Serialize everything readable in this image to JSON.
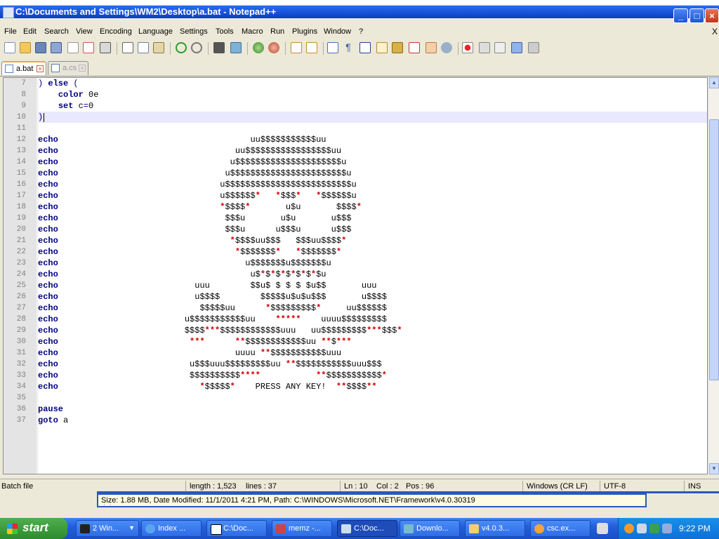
{
  "window": {
    "title": "C:\\Documents and Settings\\WM2\\Desktop\\a.bat - Notepad++",
    "minimize": "_",
    "maximize": "□",
    "close": "×"
  },
  "menu": {
    "items": [
      "File",
      "Edit",
      "Search",
      "View",
      "Encoding",
      "Language",
      "Settings",
      "Tools",
      "Macro",
      "Run",
      "Plugins",
      "Window",
      "?"
    ],
    "close_glyph": "X"
  },
  "tabs": [
    {
      "label": "a.bat",
      "active": true
    },
    {
      "label": "a.cs",
      "active": false
    }
  ],
  "editor": {
    "lines": [
      {
        "n": "7",
        "segs": [
          [
            "op",
            ") "
          ],
          [
            "kw",
            "else"
          ],
          [
            "op",
            " ("
          ]
        ]
      },
      {
        "n": "8",
        "segs": [
          [
            "st",
            "    "
          ],
          [
            "kw",
            "color"
          ],
          [
            "st",
            " 0e"
          ]
        ]
      },
      {
        "n": "9",
        "segs": [
          [
            "st",
            "    "
          ],
          [
            "kw",
            "set"
          ],
          [
            "st",
            " c"
          ],
          [
            "op",
            "="
          ],
          [
            "st",
            "0"
          ]
        ]
      },
      {
        "n": "10",
        "segs": [
          [
            "op",
            ")"
          ]
        ]
      },
      {
        "n": "11",
        "segs": []
      },
      {
        "n": "12",
        "segs": [
          [
            "kw",
            "echo"
          ],
          [
            "st",
            "                                      uu$$$$$$$$$$$uu"
          ]
        ]
      },
      {
        "n": "13",
        "segs": [
          [
            "kw",
            "echo"
          ],
          [
            "st",
            "                                   uu$$$$$$$$$$$$$$$$$uu"
          ]
        ]
      },
      {
        "n": "14",
        "segs": [
          [
            "kw",
            "echo"
          ],
          [
            "st",
            "                                  u$$$$$$$$$$$$$$$$$$$$$u"
          ]
        ]
      },
      {
        "n": "15",
        "segs": [
          [
            "kw",
            "echo"
          ],
          [
            "st",
            "                                 u$$$$$$$$$$$$$$$$$$$$$$$u"
          ]
        ]
      },
      {
        "n": "16",
        "segs": [
          [
            "kw",
            "echo"
          ],
          [
            "st",
            "                                u$$$$$$$$$$$$$$$$$$$$$$$$$u"
          ]
        ]
      },
      {
        "n": "17",
        "segs": [
          [
            "kw",
            "echo"
          ],
          [
            "st",
            "                                u$$$$$$"
          ],
          [
            "red",
            "*"
          ],
          [
            "st",
            "   "
          ],
          [
            "red",
            "*"
          ],
          [
            "st",
            "$$$"
          ],
          [
            "red",
            "*"
          ],
          [
            "st",
            "   "
          ],
          [
            "red",
            "*"
          ],
          [
            "st",
            "$$$$$$u"
          ]
        ]
      },
      {
        "n": "18",
        "segs": [
          [
            "kw",
            "echo"
          ],
          [
            "st",
            "                                "
          ],
          [
            "red",
            "*"
          ],
          [
            "st",
            "$$$$"
          ],
          [
            "red",
            "*"
          ],
          [
            "st",
            "       u$u       $$$$"
          ],
          [
            "red",
            "*"
          ]
        ]
      },
      {
        "n": "19",
        "segs": [
          [
            "kw",
            "echo"
          ],
          [
            "st",
            "                                 $$$u       u$u       u$$$"
          ]
        ]
      },
      {
        "n": "20",
        "segs": [
          [
            "kw",
            "echo"
          ],
          [
            "st",
            "                                 $$$u      u$$$u      u$$$"
          ]
        ]
      },
      {
        "n": "21",
        "segs": [
          [
            "kw",
            "echo"
          ],
          [
            "st",
            "                                  "
          ],
          [
            "red",
            "*"
          ],
          [
            "st",
            "$$$$uu$$$   $$$uu$$$$"
          ],
          [
            "red",
            "*"
          ]
        ]
      },
      {
        "n": "22",
        "segs": [
          [
            "kw",
            "echo"
          ],
          [
            "st",
            "                                   "
          ],
          [
            "red",
            "*"
          ],
          [
            "st",
            "$$$$$$$"
          ],
          [
            "red",
            "*"
          ],
          [
            "st",
            "   "
          ],
          [
            "red",
            "*"
          ],
          [
            "st",
            "$$$$$$$"
          ],
          [
            "red",
            "*"
          ]
        ]
      },
      {
        "n": "23",
        "segs": [
          [
            "kw",
            "echo"
          ],
          [
            "st",
            "                                     u$$$$$$$u$$$$$$$u"
          ]
        ]
      },
      {
        "n": "24",
        "segs": [
          [
            "kw",
            "echo"
          ],
          [
            "st",
            "                                      u$"
          ],
          [
            "red",
            "*"
          ],
          [
            "st",
            "$"
          ],
          [
            "red",
            "*"
          ],
          [
            "st",
            "$"
          ],
          [
            "red",
            "*"
          ],
          [
            "st",
            "$"
          ],
          [
            "red",
            "*"
          ],
          [
            "st",
            "$"
          ],
          [
            "red",
            "*"
          ],
          [
            "st",
            "$"
          ],
          [
            "red",
            "*"
          ],
          [
            "st",
            "$u"
          ]
        ]
      },
      {
        "n": "25",
        "segs": [
          [
            "kw",
            "echo"
          ],
          [
            "st",
            "                           uuu        $$u$ $ $ $ $u$$       uuu"
          ]
        ]
      },
      {
        "n": "26",
        "segs": [
          [
            "kw",
            "echo"
          ],
          [
            "st",
            "                           u$$$$        $$$$$u$u$u$$$       u$$$$"
          ]
        ]
      },
      {
        "n": "27",
        "segs": [
          [
            "kw",
            "echo"
          ],
          [
            "st",
            "                            $$$$$uu      "
          ],
          [
            "red",
            "*"
          ],
          [
            "st",
            "$$$$$$$$$"
          ],
          [
            "red",
            "*"
          ],
          [
            "st",
            "     uu$$$$$$"
          ]
        ]
      },
      {
        "n": "28",
        "segs": [
          [
            "kw",
            "echo"
          ],
          [
            "st",
            "                         u$$$$$$$$$$$uu    "
          ],
          [
            "red",
            "*****"
          ],
          [
            "st",
            "    uuuu$$$$$$$$$"
          ]
        ]
      },
      {
        "n": "29",
        "segs": [
          [
            "kw",
            "echo"
          ],
          [
            "st",
            "                         $$$$"
          ],
          [
            "red",
            "***"
          ],
          [
            "st",
            "$$$$$$$$$$$$uuu   uu$$$$$$$$$"
          ],
          [
            "red",
            "***"
          ],
          [
            "st",
            "$$$"
          ],
          [
            "red",
            "*"
          ]
        ]
      },
      {
        "n": "30",
        "segs": [
          [
            "kw",
            "echo"
          ],
          [
            "st",
            "                          "
          ],
          [
            "red",
            "***"
          ],
          [
            "st",
            "      "
          ],
          [
            "red",
            "**"
          ],
          [
            "st",
            "$$$$$$$$$$$$uu "
          ],
          [
            "red",
            "**"
          ],
          [
            "st",
            "$"
          ],
          [
            "red",
            "***"
          ]
        ]
      },
      {
        "n": "31",
        "segs": [
          [
            "kw",
            "echo"
          ],
          [
            "st",
            "                                   uuuu "
          ],
          [
            "red",
            "**"
          ],
          [
            "st",
            "$$$$$$$$$$$uuu"
          ]
        ]
      },
      {
        "n": "32",
        "segs": [
          [
            "kw",
            "echo"
          ],
          [
            "st",
            "                          u$$$uuu$$$$$$$$$uu "
          ],
          [
            "red",
            "**"
          ],
          [
            "st",
            "$$$$$$$$$$$uuu$$$"
          ]
        ]
      },
      {
        "n": "33",
        "segs": [
          [
            "kw",
            "echo"
          ],
          [
            "st",
            "                          $$$$$$$$$$"
          ],
          [
            "red",
            "****"
          ],
          [
            "st",
            "           "
          ],
          [
            "red",
            "**"
          ],
          [
            "st",
            "$$$$$$$$$$$"
          ],
          [
            "red",
            "*"
          ]
        ]
      },
      {
        "n": "34",
        "segs": [
          [
            "kw",
            "echo"
          ],
          [
            "st",
            "                            "
          ],
          [
            "red",
            "*"
          ],
          [
            "st",
            "$$$$$"
          ],
          [
            "red",
            "*"
          ],
          [
            "st",
            "    PRESS ANY KEY!  "
          ],
          [
            "red",
            "**"
          ],
          [
            "st",
            "$$$$"
          ],
          [
            "red",
            "**"
          ]
        ]
      },
      {
        "n": "35",
        "segs": []
      },
      {
        "n": "36",
        "segs": [
          [
            "kw",
            "pause"
          ]
        ]
      },
      {
        "n": "37",
        "segs": [
          [
            "kw",
            "goto"
          ],
          [
            "st",
            " a"
          ]
        ]
      }
    ]
  },
  "statusbar": {
    "type": "Batch file",
    "length": "length : 1,523",
    "lines": "lines : 37",
    "ln": "Ln : 10",
    "col": "Col : 2",
    "pos": "Pos : 96",
    "eol": "Windows (CR LF)",
    "encoding": "UTF-8",
    "mode": "INS"
  },
  "tooltip": {
    "text": "Size: 1.88 MB, Date Modified: 11/1/2011 4:21 PM, Path: C:\\WINDOWS\\Microsoft.NET\\Framework\\v4.0.30319"
  },
  "taskbar": {
    "start": "start",
    "tasks": [
      {
        "label": "2 Win...",
        "icon": "cmd-icon"
      },
      {
        "label": "Index ...",
        "icon": "ie-icon"
      },
      {
        "label": "C:\\Doc...",
        "icon": "7zip-icon"
      },
      {
        "label": "memz -...",
        "icon": "memz-icon"
      },
      {
        "label": "C:\\Doc...",
        "icon": "notepadpp-icon"
      },
      {
        "label": "Downlo...",
        "icon": "download-icon"
      },
      {
        "label": "v4.0.3...",
        "icon": "folder-icon"
      },
      {
        "label": "csc.ex...",
        "icon": "search-icon"
      }
    ],
    "clock": "9:22 PM"
  },
  "colors": {
    "keyword": "#00007f",
    "skull_red": "#d00000",
    "titlebar": "#0a3fc0",
    "current_line": "#e8e8ff"
  }
}
